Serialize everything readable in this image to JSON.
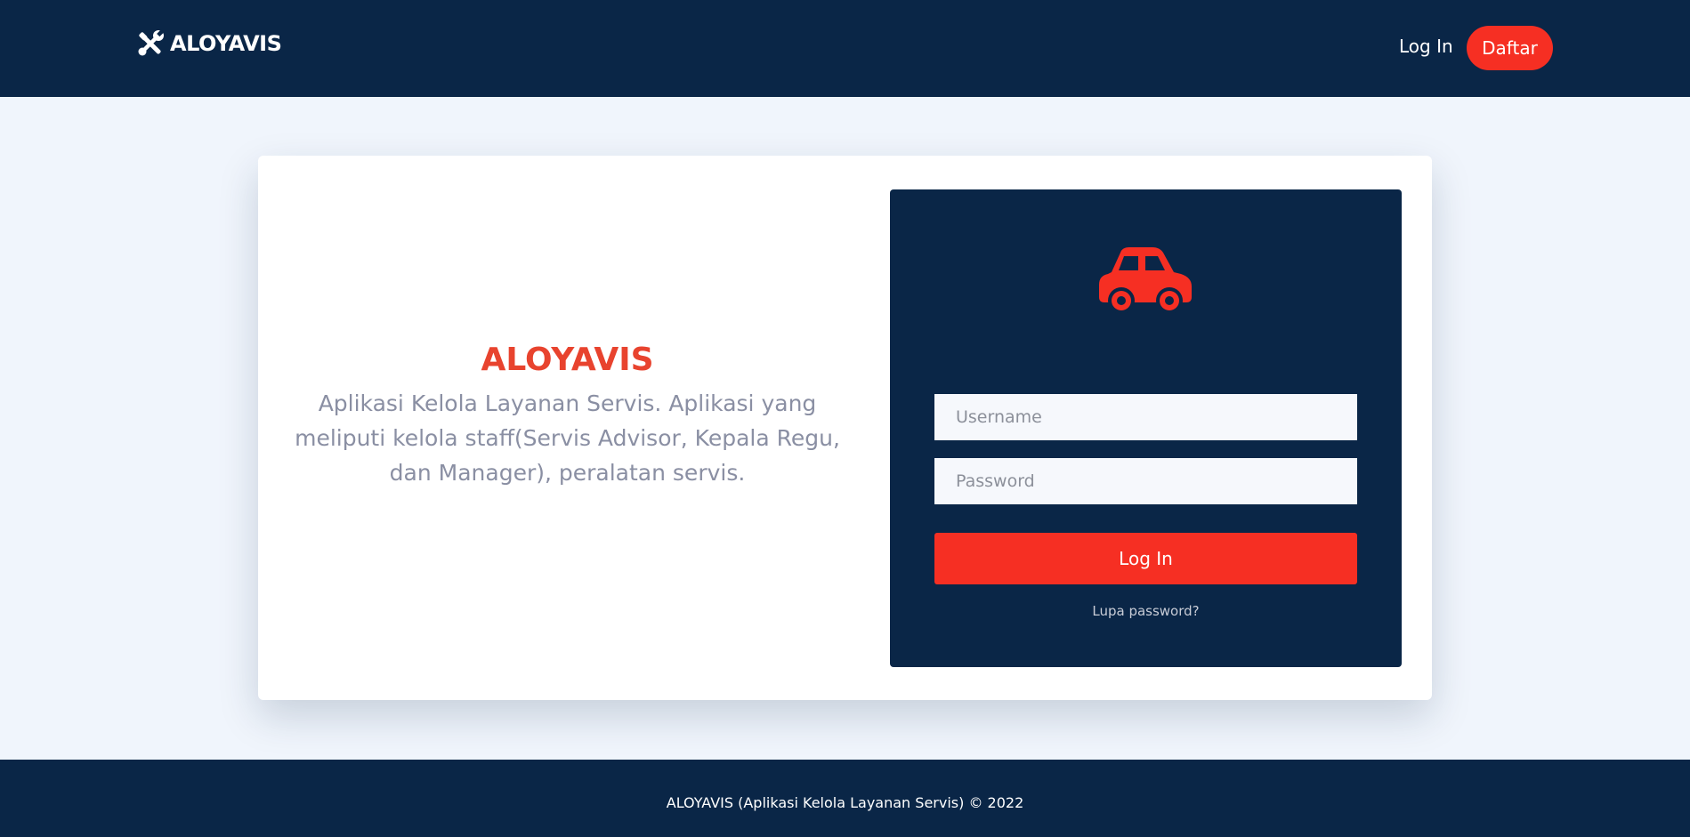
{
  "navbar": {
    "brand": "ALOYAVIS",
    "brand_icon": "tools-icon",
    "login_label": "Log In",
    "register_label": "Daftar"
  },
  "intro": {
    "title": "ALOYAVIS",
    "description": "Aplikasi Kelola Layanan Servis. Aplikasi yang meliputi kelola staff(Servis Advisor, Kepala Regu, dan Manager), peralatan servis."
  },
  "login_form": {
    "icon": "car-icon",
    "username_placeholder": "Username",
    "password_placeholder": "Password",
    "submit_label": "Log In",
    "forgot_label": "Lupa password?"
  },
  "footer": {
    "text": "ALOYAVIS (Aplikasi Kelola Layanan Servis) © 2022"
  },
  "colors": {
    "navy": "#0a2647",
    "accent": "#f62f23",
    "title_red": "#e8432e",
    "page_bg": "#f0f5fc",
    "muted_text": "#8a8fa3"
  }
}
